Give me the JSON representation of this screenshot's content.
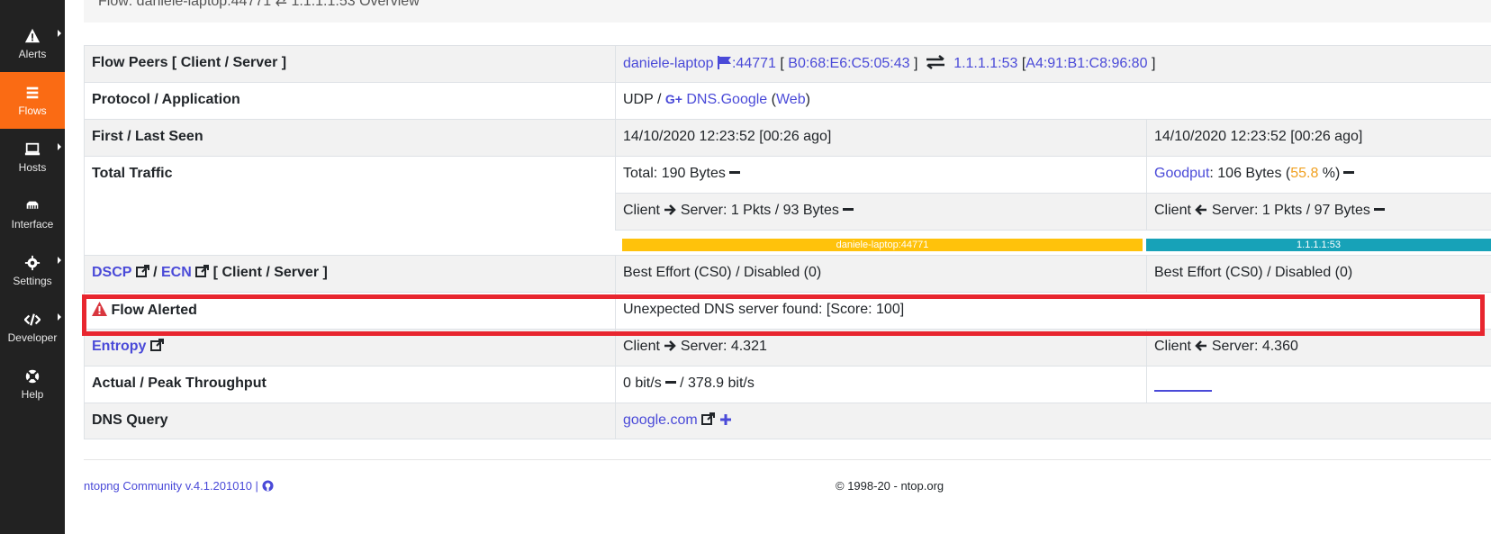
{
  "sidebar": {
    "items": [
      {
        "label": "Alerts",
        "icon": "warning-icon"
      },
      {
        "label": "Flows",
        "icon": "stack-icon",
        "active": true
      },
      {
        "label": "Hosts",
        "icon": "laptop-icon"
      },
      {
        "label": "Interface",
        "icon": "ethernet-icon"
      },
      {
        "label": "Settings",
        "icon": "gear-icon"
      },
      {
        "label": "Developer",
        "icon": "code-icon"
      },
      {
        "label": "Help",
        "icon": "lifebuoy-icon"
      }
    ]
  },
  "header": {
    "client": "Flow: daniele-laptop:44771",
    "server": "1.1.1.1:53",
    "suffix": "Overview"
  },
  "table": {
    "peers": {
      "label": "Flow Peers [ Client / Server ]",
      "client_host": "daniele-laptop",
      "client_port": ":44771",
      "bracket_open": "[",
      "bracket_close": "]",
      "client_mac": "B0:68:E6:C5:05:43",
      "server_ip": "1.1.1.1:53",
      "server_mac": "A4:91:B1:C8:96:80"
    },
    "protocol": {
      "label": "Protocol / Application",
      "l4": "UDP /",
      "app": "DNS.Google",
      "category_open": "(",
      "category": "Web",
      "category_close": ")"
    },
    "seen": {
      "label": "First / Last Seen",
      "first": "14/10/2020 12:23:52 [00:26 ago]",
      "last": "14/10/2020 12:23:52 [00:26 ago]"
    },
    "traffic": {
      "label": "Total Traffic",
      "total": "Total: 190 Bytes",
      "goodput_label": "Goodput",
      "goodput_value": ": 106 Bytes (",
      "goodput_pct": "55.8",
      "goodput_close": " %)",
      "cli2srv_prefix": "Client",
      "cli2srv_suffix": "Server: 1 Pkts / 93 Bytes",
      "srv2cli_prefix": "Client",
      "srv2cli_suffix": "Server: 1 Pkts / 97 Bytes",
      "bar_client": "daniele-laptop:44771",
      "bar_server": "1.1.1.1:53"
    },
    "dscp": {
      "dscp_label": "DSCP",
      "sep": "/",
      "ecn_label": "ECN",
      "rest": "[ Client / Server ]",
      "client": "Best Effort (CS0) / Disabled (0)",
      "server": "Best Effort (CS0) / Disabled (0)"
    },
    "alerted": {
      "label": "Flow Alerted",
      "value": "Unexpected DNS server found: [Score: 100]"
    },
    "entropy": {
      "label": "Entropy",
      "cli_prefix": "Client",
      "cli_suffix": "Server: 4.321",
      "srv_prefix": "Client",
      "srv_suffix": "Server: 4.360"
    },
    "throughput": {
      "label": "Actual / Peak Throughput",
      "actual": "0 bit/s",
      "peak": "/ 378.9 bit/s"
    },
    "dns": {
      "label": "DNS Query",
      "query": "google.com"
    }
  },
  "footer": {
    "version": "ntopng Community v.4.1.201010 |",
    "copyright": "© 1998-20 - ntop.org"
  },
  "colors": {
    "sidebar_bg": "#222222",
    "active_orange": "#fa6b14",
    "link": "#4a4ad8",
    "bar_yellow": "#ffc20b",
    "bar_teal": "#17a2b8",
    "alert_red": "#e8262f"
  }
}
